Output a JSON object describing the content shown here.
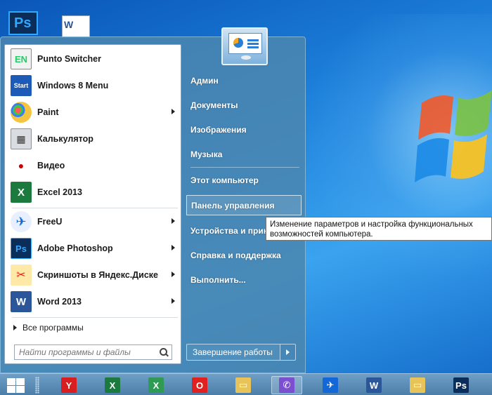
{
  "desktop": {
    "icons": [
      {
        "name": "photoshop-desktop-icon",
        "glyph": "Ps"
      },
      {
        "name": "word-document-desktop-icon",
        "glyph": "W"
      }
    ]
  },
  "start_menu": {
    "programs": [
      {
        "label": "Punto Switcher",
        "icon": "punto-switcher-icon",
        "glyph": "EN",
        "has_arrow": false
      },
      {
        "label": "Windows 8 Menu",
        "icon": "windows8-menu-icon",
        "glyph": "Start",
        "has_arrow": false
      },
      {
        "label": "Paint",
        "icon": "paint-palette-icon",
        "glyph": "",
        "has_arrow": true
      },
      {
        "label": "Калькулятор",
        "icon": "calculator-icon",
        "glyph": "▦",
        "has_arrow": false
      },
      {
        "label": "Видео",
        "icon": "video-icon",
        "glyph": "●",
        "has_arrow": false
      },
      {
        "label": "Excel 2013",
        "icon": "excel-icon",
        "glyph": "X",
        "has_arrow": false
      },
      {
        "label": "FreeU",
        "icon": "freeu-icon",
        "glyph": "✈",
        "has_arrow": true
      },
      {
        "label": "Adobe Photoshop",
        "icon": "photoshop-icon",
        "glyph": "Ps",
        "has_arrow": true
      },
      {
        "label": "Скриншоты в Яндекс.Диске",
        "icon": "yandex-screenshot-icon",
        "glyph": "✂",
        "has_arrow": true
      },
      {
        "label": "Word 2013",
        "icon": "word-icon",
        "glyph": "W",
        "has_arrow": true
      }
    ],
    "all_programs": "Все программы",
    "search_placeholder": "Найти программы и файлы",
    "right_items": [
      {
        "label": "Админ"
      },
      {
        "label": "Документы"
      },
      {
        "label": "Изображения"
      },
      {
        "label": "Музыка"
      },
      {
        "label": "Этот компьютер"
      },
      {
        "label": "Панель управления"
      },
      {
        "label": "Устройства и принтеры"
      },
      {
        "label": "Справка и поддержка"
      },
      {
        "label": "Выполнить..."
      }
    ],
    "hovered_item": "Панель управления",
    "shutdown_label": "Завершение работы"
  },
  "tooltip": {
    "line1": "Изменение параметров и настройка функциональных",
    "line2": "возможностей компьютера."
  },
  "taskbar": {
    "apps": [
      {
        "name": "taskbar-yandex-browser",
        "glyph": "Y",
        "color": "#d81e1e",
        "active": false
      },
      {
        "name": "taskbar-excel",
        "glyph": "X",
        "color": "#1d7a3e",
        "active": false
      },
      {
        "name": "taskbar-excel-file",
        "glyph": "X",
        "color": "#2e9a54",
        "active": false
      },
      {
        "name": "taskbar-opera",
        "glyph": "O",
        "color": "#e0211f",
        "active": false
      },
      {
        "name": "taskbar-explorer",
        "glyph": "▭",
        "color": "#e8c35a",
        "active": false
      },
      {
        "name": "taskbar-viber",
        "glyph": "✆",
        "color": "#7c4fd0",
        "active": true
      },
      {
        "name": "taskbar-freeu",
        "glyph": "✈",
        "color": "#1467d6",
        "active": false
      },
      {
        "name": "taskbar-word",
        "glyph": "W",
        "color": "#2b579a",
        "active": false
      },
      {
        "name": "taskbar-folder",
        "glyph": "▭",
        "color": "#e8c35a",
        "active": false
      },
      {
        "name": "taskbar-photoshop",
        "glyph": "Ps",
        "color": "#0b2d5a",
        "active": false
      }
    ]
  }
}
